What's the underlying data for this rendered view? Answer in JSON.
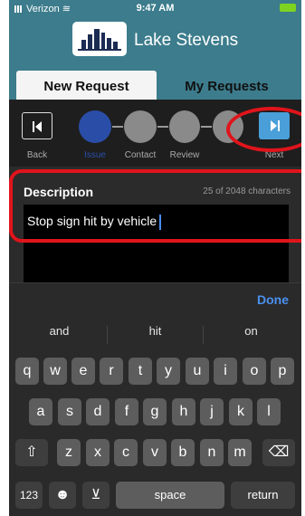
{
  "status": {
    "carrier": "Verizon",
    "time": "9:47 AM"
  },
  "app": {
    "title": "Lake Stevens"
  },
  "tabs": [
    {
      "label": "New Request"
    },
    {
      "label": "My Requests"
    }
  ],
  "steps": {
    "back": "Back",
    "labels": [
      "Issue",
      "Contact",
      "Review"
    ],
    "next": "Next"
  },
  "description": {
    "label": "Description",
    "count": "25 of 2048 characters",
    "value": "Stop sign hit by vehicle"
  },
  "done": "Done",
  "keyboard": {
    "suggestions": [
      "and",
      "hit",
      "on"
    ],
    "row1": [
      "q",
      "w",
      "e",
      "r",
      "t",
      "y",
      "u",
      "i",
      "o",
      "p"
    ],
    "row2": [
      "a",
      "s",
      "d",
      "f",
      "g",
      "h",
      "j",
      "k",
      "l"
    ],
    "row3": [
      "z",
      "x",
      "c",
      "v",
      "b",
      "n",
      "m"
    ],
    "numbers": "123",
    "space": "space",
    "return": "return"
  },
  "colors": {
    "header": "#3c7c8c",
    "active_step": "#2a4ea8",
    "next_button": "#4a9fd8",
    "annotation": "#e0141b",
    "done": "#4a90f0"
  }
}
